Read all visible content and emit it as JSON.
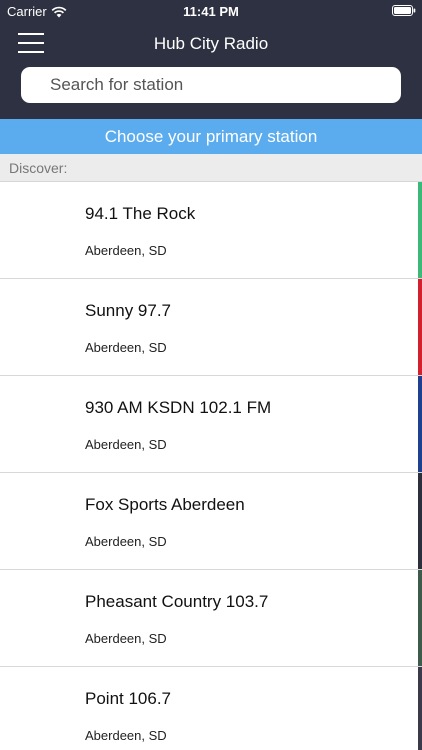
{
  "status_bar": {
    "carrier": "Carrier",
    "time": "11:41 PM"
  },
  "nav": {
    "title": "Hub City Radio"
  },
  "search": {
    "placeholder": "Search for station",
    "value": ""
  },
  "banner": {
    "label": "Choose your primary station"
  },
  "section": {
    "label": "Discover:"
  },
  "stations": [
    {
      "name": "94.1 The Rock",
      "location": "Aberdeen, SD",
      "color": "#3cb878"
    },
    {
      "name": "Sunny 97.7",
      "location": "Aberdeen, SD",
      "color": "#d3202f"
    },
    {
      "name": "930 AM KSDN 102.1 FM",
      "location": "Aberdeen, SD",
      "color": "#1f3f8f"
    },
    {
      "name": "Fox Sports Aberdeen",
      "location": "Aberdeen, SD",
      "color": "#2c2f3c"
    },
    {
      "name": "Pheasant Country 103.7",
      "location": "Aberdeen, SD",
      "color": "#3d5a4a"
    },
    {
      "name": "Point 106.7",
      "location": "Aberdeen, SD",
      "color": "#3a3a4a"
    }
  ],
  "colors": {
    "header_bg": "#2e3141",
    "banner_bg": "#5aacee"
  }
}
